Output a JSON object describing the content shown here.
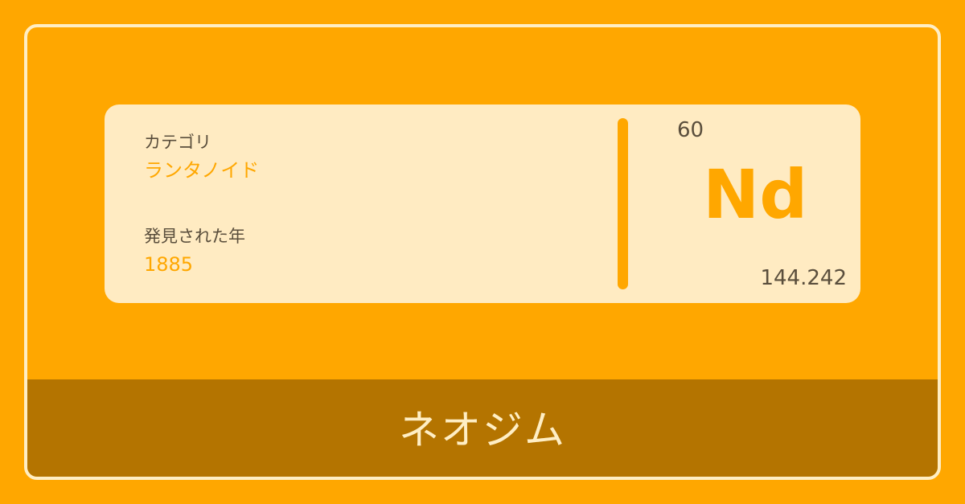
{
  "colors": {
    "background": "#ffa700",
    "card": "#ffebc2",
    "footer": "#b47400",
    "accent": "#ffa700",
    "text_dark": "#5a4e3c",
    "text_light": "#ffeec4"
  },
  "element": {
    "category_label": "カテゴリ",
    "category_value": "ランタノイド",
    "discovered_label": "発見された年",
    "discovered_value": "1885",
    "atomic_number": "60",
    "symbol": "Nd",
    "atomic_mass": "144.242",
    "name": "ネオジム"
  }
}
